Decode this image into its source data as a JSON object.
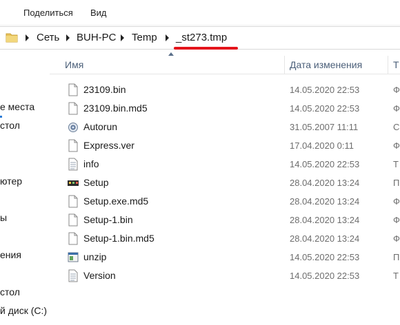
{
  "menu": {
    "share": "Поделиться",
    "view": "Вид"
  },
  "address": {
    "crumbs": [
      "Сеть",
      "BUH-PC",
      "Temp",
      "_st273.tmp"
    ]
  },
  "nav": {
    "items": [
      "е места",
      "стол",
      "ютер",
      "ы",
      "ения",
      "стол",
      "й диск (C:)"
    ]
  },
  "columns": {
    "name": "Имя",
    "date": "Дата изменения",
    "type": "Т"
  },
  "files": [
    {
      "name": "23109.bin",
      "date": "14.05.2020 22:53",
      "type": "Ф",
      "icon": "file-icon"
    },
    {
      "name": "23109.bin.md5",
      "date": "14.05.2020 22:53",
      "type": "Ф",
      "icon": "file-icon"
    },
    {
      "name": "Autorun",
      "date": "31.05.2007 11:11",
      "type": "С",
      "icon": "autorun-icon"
    },
    {
      "name": "Express.ver",
      "date": "17.04.2020 0:11",
      "type": "Ф",
      "icon": "file-icon"
    },
    {
      "name": "info",
      "date": "14.05.2020 22:53",
      "type": "Т",
      "icon": "text-file-icon"
    },
    {
      "name": "Setup",
      "date": "28.04.2020 13:24",
      "type": "П",
      "icon": "setup-app-icon"
    },
    {
      "name": "Setup.exe.md5",
      "date": "28.04.2020 13:24",
      "type": "Ф",
      "icon": "file-icon"
    },
    {
      "name": "Setup-1.bin",
      "date": "28.04.2020 13:24",
      "type": "Ф",
      "icon": "file-icon"
    },
    {
      "name": "Setup-1.bin.md5",
      "date": "28.04.2020 13:24",
      "type": "Ф",
      "icon": "file-icon"
    },
    {
      "name": "unzip",
      "date": "14.05.2020 22:53",
      "type": "П",
      "icon": "unzip-app-icon"
    },
    {
      "name": "Version",
      "date": "14.05.2020 22:53",
      "type": "Т",
      "icon": "text-file-icon"
    }
  ],
  "colors": {
    "annotation_underline": "#e4141b",
    "header_text": "#4c607a"
  }
}
